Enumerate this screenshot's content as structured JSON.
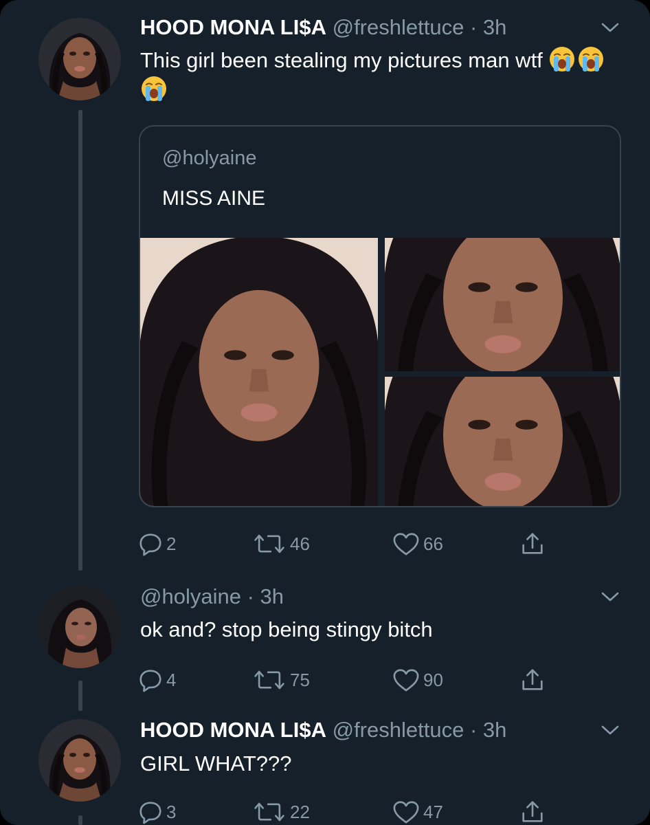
{
  "colors": {
    "background": "#15202b",
    "text": "#ffffff",
    "secondary": "#8899a6",
    "border": "#38444d"
  },
  "tweets": [
    {
      "name": "HOOD MONA LI$A",
      "handle": "@freshlettuce",
      "separator": "·",
      "time": "3h",
      "text": "This girl been stealing my pictures man wtf",
      "emoji": [
        "loudly-crying-face",
        "loudly-crying-face",
        "loudly-crying-face"
      ],
      "quote": {
        "handle": "@holyaine",
        "text": "MISS AINE",
        "photo_count": 3
      },
      "actions": {
        "replies": "2",
        "retweets": "46",
        "likes": "66"
      }
    },
    {
      "name": "",
      "handle": "@holyaine",
      "separator": "·",
      "time": "3h",
      "text": "ok and? stop being stingy bitch",
      "actions": {
        "replies": "4",
        "retweets": "75",
        "likes": "90"
      }
    },
    {
      "name": "HOOD MONA LI$A",
      "handle": "@freshlettuce",
      "separator": "·",
      "time": "3h",
      "text": "GIRL WHAT???",
      "actions": {
        "replies": "3",
        "retweets": "22",
        "likes": "47"
      }
    }
  ],
  "icons": {
    "reply": "reply-icon",
    "retweet": "retweet-icon",
    "like": "heart-icon",
    "share": "share-icon",
    "menu": "chevron-down-icon"
  }
}
